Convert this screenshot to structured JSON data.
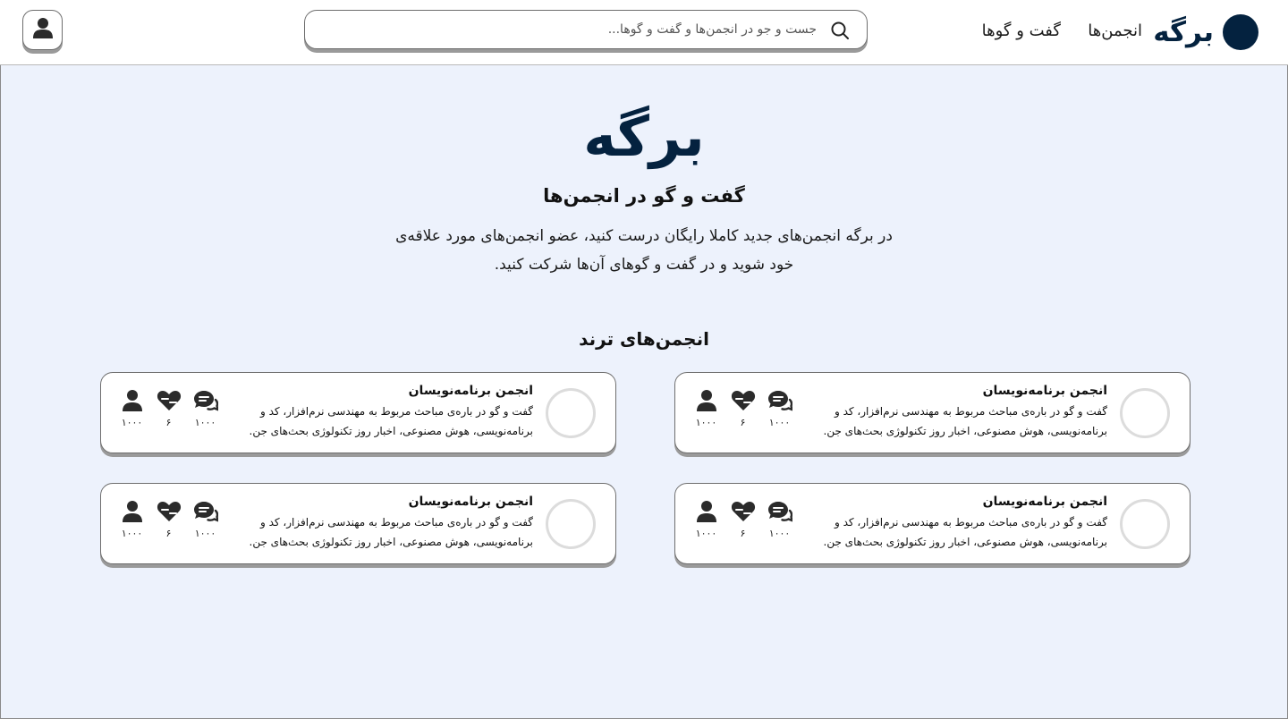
{
  "header": {
    "brand_name": "برگه",
    "nav": {
      "communities": "انجمن‌ها",
      "chats": "گفت و گوها"
    },
    "search_placeholder": "جست و جو در انجمن‌ها و گفت و گوها..."
  },
  "hero": {
    "logo": "برگه",
    "subtitle": "گفت و گو در انجمن‌ها",
    "description": "در برگه انجمن‌های جدید کاملا رایگان درست کنید، عضو انجمن‌های مورد علاقه‌ی خود شوید و در گفت و گوهای آن‌ها شرکت کنید."
  },
  "trending": {
    "title": "انجمن‌های ترند",
    "cards": [
      {
        "title": "انجمن برنامه‌نویسان",
        "description": "گفت و گو در باره‌ی مباحث مربوط به مهندسی نرم‌افزار، کد و برنامه‌نویسی، هوش مصنوعی، اخبار روز تکنولوژی بحث‌های جن.",
        "members": "۱۰۰۰",
        "likes": "۶",
        "chats": "۱۰۰۰"
      },
      {
        "title": "انجمن برنامه‌نویسان",
        "description": "گفت و گو در باره‌ی مباحث مربوط به مهندسی نرم‌افزار، کد و برنامه‌نویسی، هوش مصنوعی، اخبار روز تکنولوژی بحث‌های جن.",
        "members": "۱۰۰۰",
        "likes": "۶",
        "chats": "۱۰۰۰"
      },
      {
        "title": "انجمن برنامه‌نویسان",
        "description": "گفت و گو در باره‌ی مباحث مربوط به مهندسی نرم‌افزار، کد و برنامه‌نویسی، هوش مصنوعی، اخبار روز تکنولوژی بحث‌های جن.",
        "members": "۱۰۰۰",
        "likes": "۶",
        "chats": "۱۰۰۰"
      },
      {
        "title": "انجمن برنامه‌نویسان",
        "description": "گفت و گو در باره‌ی مباحث مربوط به مهندسی نرم‌افزار، کد و برنامه‌نویسی، هوش مصنوعی، اخبار روز تکنولوژی بحث‌های جن.",
        "members": "۱۰۰۰",
        "likes": "۶",
        "chats": "۱۰۰۰"
      }
    ]
  },
  "icons": {
    "search": "search-icon",
    "profile": "user-icon",
    "members": "user-icon",
    "likes": "handshake-heart-icon",
    "chats": "chat-bubbles-icon"
  },
  "colors": {
    "brand": "#04223f",
    "background": "#edf2fc",
    "card_border": "#6e6e6e"
  }
}
